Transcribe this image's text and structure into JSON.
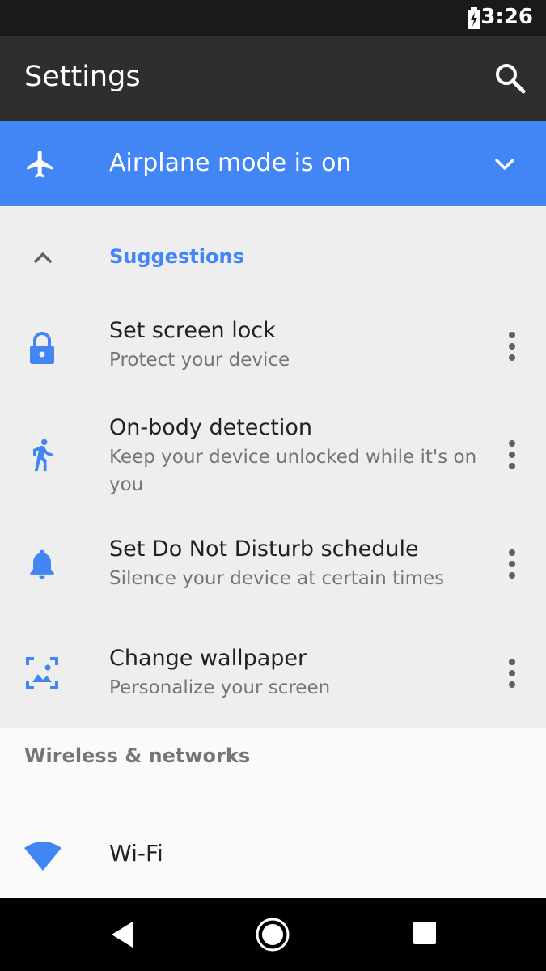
{
  "status_bar": {
    "time": "3:26",
    "battery_icon": "battery-charging-icon"
  },
  "app_bar": {
    "title": "Settings",
    "search_icon": "search-icon"
  },
  "airplane_banner": {
    "text": "Airplane mode is on",
    "icon": "airplane-icon",
    "expand_icon": "chevron-down-icon"
  },
  "suggestions": {
    "title": "Suggestions",
    "collapse_icon": "chevron-up-icon",
    "items": [
      {
        "title": "Set screen lock",
        "subtitle": "Protect your device",
        "icon": "lock-icon"
      },
      {
        "title": "On-body detection",
        "subtitle": "Keep your device unlocked while it's on you",
        "icon": "walking-person-icon"
      },
      {
        "title": "Set Do Not Disturb schedule",
        "subtitle": "Silence your device at certain times",
        "icon": "bell-icon"
      },
      {
        "title": "Change wallpaper",
        "subtitle": "Personalize your screen",
        "icon": "wallpaper-icon"
      }
    ]
  },
  "wireless": {
    "header": "Wireless & networks",
    "wifi_label": "Wi-Fi",
    "wifi_icon": "wifi-icon"
  },
  "nav_bar": {
    "back_icon": "back-icon",
    "home_icon": "home-icon",
    "recents_icon": "recents-icon"
  },
  "colors": {
    "accent": "#4285f4",
    "app_bar": "#2e2e2e",
    "status_bar": "#1a1a1a",
    "suggestions_bg": "#eeeeee"
  }
}
